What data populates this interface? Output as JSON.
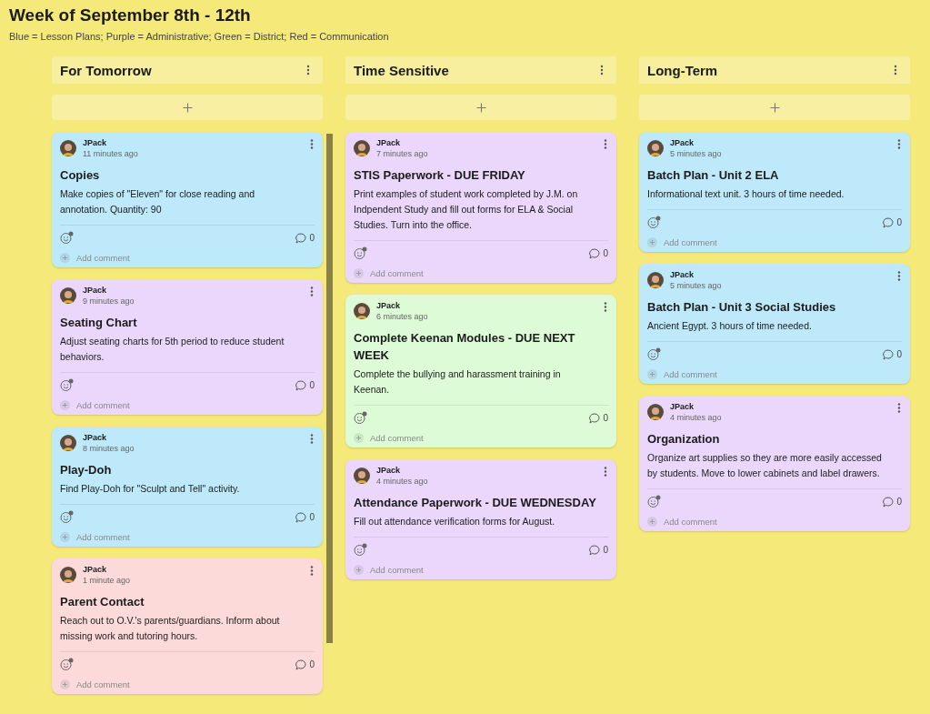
{
  "board": {
    "title": "Week of September 8th - 12th",
    "legend": "Blue = Lesson Plans; Purple = Administrative; Green = District; Red = Communication"
  },
  "columns": [
    {
      "title": "For Tomorrow",
      "cards": [
        {
          "author": "JPack",
          "time": "11 minutes ago",
          "title": "Copies",
          "body": "Make copies of \"Eleven\" for close reading and annotation. Quantity: 90",
          "color": "#bde9fb",
          "comments": "0",
          "add_comment": "Add comment"
        },
        {
          "author": "JPack",
          "time": "9 minutes ago",
          "title": "Seating Chart",
          "body": "Adjust seating charts for 5th period to reduce student behaviors.",
          "color": "#ebd7fb",
          "comments": "0",
          "add_comment": "Add comment"
        },
        {
          "author": "JPack",
          "time": "8 minutes ago",
          "title": "Play-Doh",
          "body": "Find Play-Doh for \"Sculpt and Tell\" activity.",
          "color": "#bde9fb",
          "comments": "0",
          "add_comment": "Add comment"
        },
        {
          "author": "JPack",
          "time": "1 minute ago",
          "title": "Parent Contact",
          "body": "Reach out to O.V.'s parents/guardians. Inform about missing work and tutoring hours.",
          "color": "#fcdada",
          "comments": "0",
          "add_comment": "Add comment"
        }
      ]
    },
    {
      "title": "Time Sensitive",
      "cards": [
        {
          "author": "JPack",
          "time": "7 minutes ago",
          "title": "STIS Paperwork - DUE FRIDAY",
          "body": "Print examples of student work completed by J.M. on Indpendent Study and fill out forms for ELA & Social Studies. Turn into the office.",
          "color": "#ebd7fb",
          "comments": "0",
          "add_comment": "Add comment"
        },
        {
          "author": "JPack",
          "time": "6 minutes ago",
          "title": "Complete Keenan Modules - DUE NEXT WEEK",
          "body": "Complete the bullying and harassment training in Keenan.",
          "color": "#dcfbd6",
          "comments": "0",
          "add_comment": "Add comment"
        },
        {
          "author": "JPack",
          "time": "4 minutes ago",
          "title": "Attendance Paperwork - DUE WEDNESDAY",
          "body": "Fill out attendance verification forms for August.",
          "color": "#ebd7fb",
          "comments": "0",
          "add_comment": "Add comment"
        }
      ]
    },
    {
      "title": "Long-Term",
      "cards": [
        {
          "author": "JPack",
          "time": "5 minutes ago",
          "title": "Batch Plan - Unit 2 ELA",
          "body": "Informational text unit. 3 hours of time needed.",
          "color": "#bde9fb",
          "comments": "0",
          "add_comment": "Add comment"
        },
        {
          "author": "JPack",
          "time": "5 minutes ago",
          "title": "Batch Plan - Unit 3 Social Studies",
          "body": "Ancient Egypt. 3 hours of time needed.",
          "color": "#bde9fb",
          "comments": "0",
          "add_comment": "Add comment"
        },
        {
          "author": "JPack",
          "time": "4 minutes ago",
          "title": "Organization",
          "body": "Organize art supplies so they are more easily accessed by students. Move to lower cabinets and label drawers.",
          "color": "#ebd7fb",
          "comments": "0",
          "add_comment": "Add comment"
        }
      ]
    }
  ]
}
